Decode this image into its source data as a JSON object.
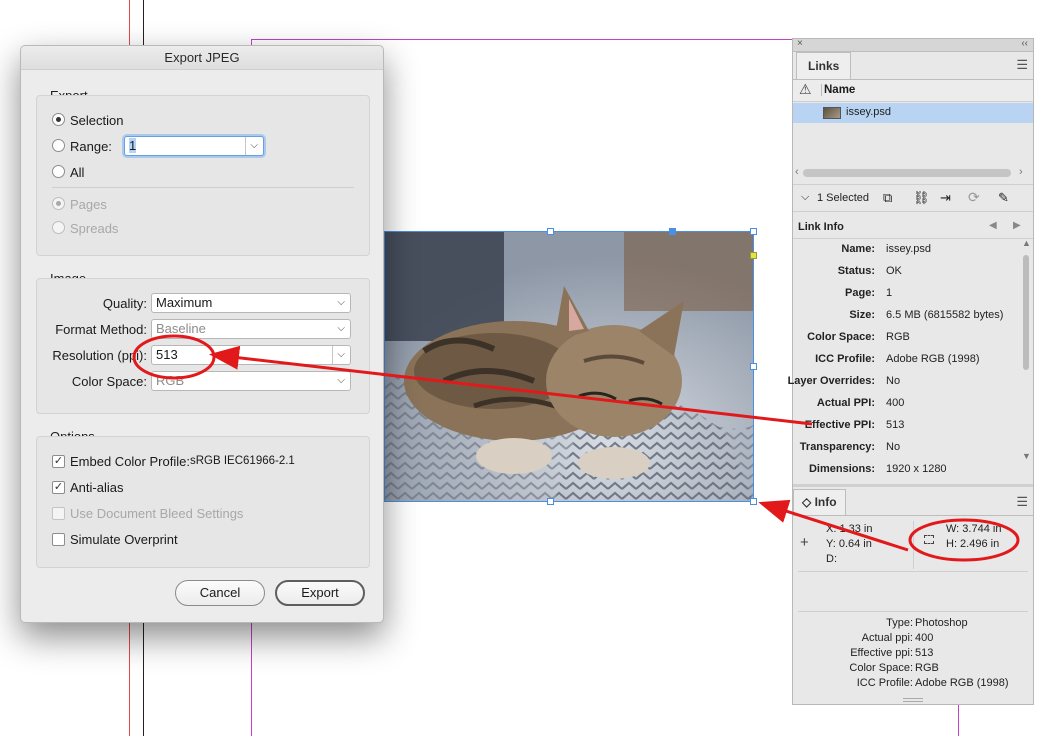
{
  "dialog": {
    "title": "Export JPEG",
    "export_group": "Export",
    "export_options": [
      {
        "label": "Selection",
        "selected": true
      },
      {
        "label": "Range:",
        "selected": false
      },
      {
        "label": "All",
        "selected": false
      }
    ],
    "range_value": "1",
    "range_chevron": "⌵",
    "pages_label": "Pages",
    "spreads_label": "Spreads",
    "image_group": "Image",
    "quality_label": "Quality:",
    "quality_value": "Maximum",
    "format_label": "Format Method:",
    "format_value": "Baseline",
    "resolution_label": "Resolution (ppi):",
    "resolution_value": "513",
    "colorspace_label": "Color Space:",
    "colorspace_value": "RGB",
    "options_group": "Options",
    "options": [
      {
        "label": "Embed Color Profile:",
        "extra": "sRGB IEC61966-2.1",
        "checked": true,
        "enabled": true
      },
      {
        "label": "Anti-alias",
        "checked": true,
        "enabled": true
      },
      {
        "label": "Use Document Bleed Settings",
        "checked": false,
        "enabled": false
      },
      {
        "label": "Simulate Overprint",
        "checked": false,
        "enabled": true
      }
    ],
    "cancel_label": "Cancel",
    "export_label": "Export"
  },
  "links_panel": {
    "close_glyph": "×",
    "collapse_glyph": "‹‹",
    "tab": "Links",
    "warning_glyph": "⚠",
    "name_header": "Name",
    "file": "issey.psd",
    "selected_count": "1 Selected",
    "toolbar_glyph": "⌵",
    "link_info_label": "Link Info",
    "nav_prev": "◀",
    "nav_next": "▶",
    "link_info": [
      {
        "key": "Name:",
        "value": "issey.psd"
      },
      {
        "key": "Status:",
        "value": "OK"
      },
      {
        "key": "Page:",
        "value": "1"
      },
      {
        "key": "Size:",
        "value": "6.5 MB (6815582 bytes)"
      },
      {
        "key": "Color Space:",
        "value": "RGB"
      },
      {
        "key": "ICC Profile:",
        "value": "Adobe RGB (1998)"
      },
      {
        "key": "Layer Overrides:",
        "value": "No"
      },
      {
        "key": "Actual PPI:",
        "value": "400"
      },
      {
        "key": "Effective PPI:",
        "value": "513"
      },
      {
        "key": "Transparency:",
        "value": "No"
      },
      {
        "key": "Dimensions:",
        "value": "1920 x 1280"
      }
    ]
  },
  "info_panel": {
    "tab": "◇ Info",
    "x": "X: 1.33 in",
    "y": "Y: 0.64 in",
    "d": "D:",
    "w": "W: 3.744 in",
    "h": "H: 2.496 in",
    "details": [
      {
        "key": "Type:",
        "value": "Photoshop"
      },
      {
        "key": "Actual ppi:",
        "value": "400"
      },
      {
        "key": "Effective ppi:",
        "value": "513"
      },
      {
        "key": "Color Space:",
        "value": "RGB"
      },
      {
        "key": "ICC Profile:",
        "value": "Adobe RGB (1998)"
      }
    ]
  },
  "colors": {
    "annotation_red": "#e2191b",
    "selection_blue": "#4a8fe0",
    "guide_magenta": "#c640c8"
  }
}
